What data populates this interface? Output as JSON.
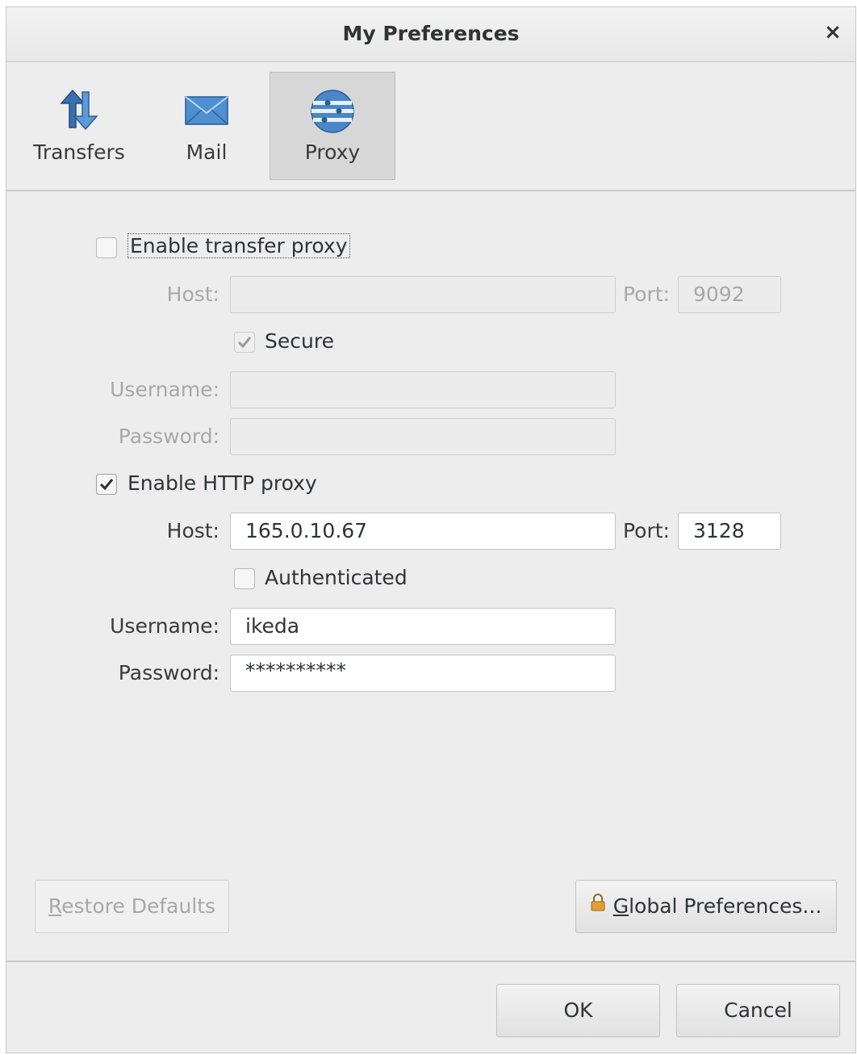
{
  "window": {
    "title": "My Preferences",
    "close_icon": "×"
  },
  "toolbar": {
    "items": [
      {
        "label": "Transfers",
        "icon": "transfers-icon"
      },
      {
        "label": "Mail",
        "icon": "mail-icon"
      },
      {
        "label": "Proxy",
        "icon": "proxy-icon",
        "active": true
      }
    ]
  },
  "transfer_proxy": {
    "enable_label": "Enable transfer proxy",
    "enabled": false,
    "host_label": "Host:",
    "host_value": "",
    "port_label": "Port:",
    "port_value": "9092",
    "secure_label": "Secure",
    "secure_checked": true,
    "username_label": "Username:",
    "username_value": "",
    "password_label": "Password:",
    "password_value": ""
  },
  "http_proxy": {
    "enable_label": "Enable HTTP proxy",
    "enabled": true,
    "host_label": "Host:",
    "host_value": "165.0.10.67",
    "port_label": "Port:",
    "port_value": "3128",
    "auth_label": "Authenticated",
    "auth_checked": false,
    "username_label": "Username:",
    "username_value": "ikeda",
    "password_label": "Password:",
    "password_value": "**********"
  },
  "buttons": {
    "restore_defaults": "Restore Defaults",
    "global_preferences": "Global Preferences...",
    "ok": "OK",
    "cancel": "Cancel"
  },
  "colors": {
    "dialog_bg": "#ededed",
    "disabled_text": "#a8a8a8",
    "text": "#2e3436"
  }
}
